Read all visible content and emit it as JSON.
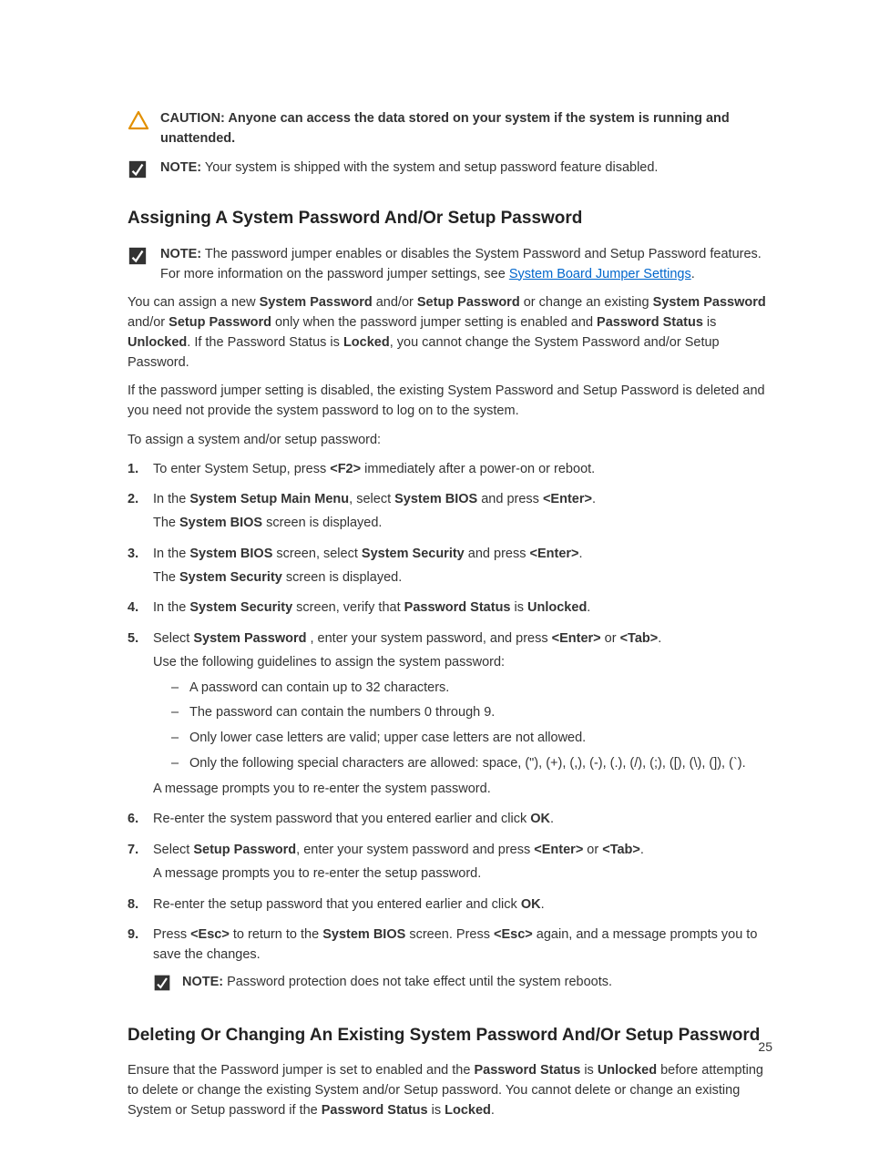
{
  "caution": {
    "label": "CAUTION:",
    "text": "Anyone can access the data stored on your system if the system is running and unattended."
  },
  "note1": {
    "label": "NOTE:",
    "text": "Your system is shipped with the system and setup password feature disabled."
  },
  "heading1": "Assigning A System Password And/Or Setup Password",
  "note2": {
    "label": "NOTE:",
    "pre": "The password jumper enables or disables the System Password and Setup Password features. For more information on the password jumper settings, see ",
    "link": "System Board Jumper Settings",
    "post": "."
  },
  "para1": {
    "p1": "You can assign a new ",
    "b1": "System Password",
    "p2": " and/or ",
    "b2": "Setup Password",
    "p3": " or change an existing ",
    "b3": "System Password",
    "p4": " and/or ",
    "b4": "Setup Password",
    "p5": " only when the password jumper setting is enabled and ",
    "b5": "Password Status",
    "p6": " is ",
    "b6": "Unlocked",
    "p7": ". If the Password Status is ",
    "b7": "Locked",
    "p8": ", you cannot change the System Password and/or Setup Password."
  },
  "para2": "If the password jumper setting is disabled, the existing System Password and Setup Password is deleted and you need not provide the system password to log on to the system.",
  "para3": "To assign a system and/or setup password:",
  "steps": [
    {
      "n": "1.",
      "lines": [
        {
          "segs": [
            {
              "t": "To enter System Setup, press "
            },
            {
              "t": "<F2>",
              "b": true
            },
            {
              "t": " immediately after a power-on or reboot."
            }
          ]
        }
      ]
    },
    {
      "n": "2.",
      "lines": [
        {
          "segs": [
            {
              "t": "In the "
            },
            {
              "t": "System Setup Main Menu",
              "b": true
            },
            {
              "t": ", select "
            },
            {
              "t": "System BIOS",
              "b": true
            },
            {
              "t": " and press "
            },
            {
              "t": "<Enter>",
              "b": true
            },
            {
              "t": "."
            }
          ]
        },
        {
          "segs": [
            {
              "t": "The "
            },
            {
              "t": "System BIOS",
              "b": true
            },
            {
              "t": " screen is displayed."
            }
          ]
        }
      ]
    },
    {
      "n": "3.",
      "lines": [
        {
          "segs": [
            {
              "t": "In the "
            },
            {
              "t": "System BIOS",
              "b": true
            },
            {
              "t": " screen, select "
            },
            {
              "t": "System Security",
              "b": true
            },
            {
              "t": " and press "
            },
            {
              "t": "<Enter>",
              "b": true
            },
            {
              "t": "."
            }
          ]
        },
        {
          "segs": [
            {
              "t": "The "
            },
            {
              "t": "System Security",
              "b": true
            },
            {
              "t": " screen is displayed."
            }
          ]
        }
      ]
    },
    {
      "n": "4.",
      "lines": [
        {
          "segs": [
            {
              "t": "In the "
            },
            {
              "t": "System Security",
              "b": true
            },
            {
              "t": " screen, verify that "
            },
            {
              "t": "Password Status",
              "b": true
            },
            {
              "t": " is "
            },
            {
              "t": "Unlocked",
              "b": true
            },
            {
              "t": "."
            }
          ]
        }
      ]
    },
    {
      "n": "5.",
      "lines": [
        {
          "segs": [
            {
              "t": "Select "
            },
            {
              "t": "System Password",
              "b": true
            },
            {
              "t": " , enter your system password, and press "
            },
            {
              "t": "<Enter>",
              "b": true
            },
            {
              "t": " or "
            },
            {
              "t": "<Tab>",
              "b": true
            },
            {
              "t": "."
            }
          ]
        },
        {
          "segs": [
            {
              "t": "Use the following guidelines to assign the system password:"
            }
          ]
        }
      ],
      "bullets": [
        "A password can contain up to 32 characters.",
        "The password can contain the numbers 0 through 9.",
        "Only lower case letters are valid; upper case letters are not allowed.",
        "Only the following special characters are allowed: space, (\"), (+), (,), (-), (.), (/), (;), ([), (\\), (]), (`)."
      ],
      "after": [
        {
          "segs": [
            {
              "t": "A message prompts you to re-enter the system password."
            }
          ]
        }
      ]
    },
    {
      "n": "6.",
      "lines": [
        {
          "segs": [
            {
              "t": "Re-enter the system password that you entered earlier and click "
            },
            {
              "t": "OK",
              "b": true
            },
            {
              "t": "."
            }
          ]
        }
      ]
    },
    {
      "n": "7.",
      "lines": [
        {
          "segs": [
            {
              "t": "Select "
            },
            {
              "t": "Setup Password",
              "b": true
            },
            {
              "t": ", enter your system password and press "
            },
            {
              "t": "<Enter>",
              "b": true
            },
            {
              "t": " or "
            },
            {
              "t": "<Tab>",
              "b": true
            },
            {
              "t": "."
            }
          ]
        },
        {
          "segs": [
            {
              "t": "A message prompts you to re-enter the setup password."
            }
          ]
        }
      ]
    },
    {
      "n": "8.",
      "lines": [
        {
          "segs": [
            {
              "t": "Re-enter the setup password that you entered earlier and click "
            },
            {
              "t": "OK",
              "b": true
            },
            {
              "t": "."
            }
          ]
        }
      ]
    },
    {
      "n": "9.",
      "lines": [
        {
          "segs": [
            {
              "t": "Press "
            },
            {
              "t": "<Esc>",
              "b": true
            },
            {
              "t": " to return to the "
            },
            {
              "t": "System BIOS",
              "b": true
            },
            {
              "t": " screen. Press "
            },
            {
              "t": "<Esc>",
              "b": true
            },
            {
              "t": " again, and a message prompts you to save the changes."
            }
          ]
        }
      ],
      "note": {
        "label": "NOTE:",
        "text": "Password protection does not take effect until the system reboots."
      }
    }
  ],
  "heading2": "Deleting Or Changing An Existing System Password And/Or Setup Password",
  "para4": {
    "p1": "Ensure that the Password jumper is set to enabled and the ",
    "b1": "Password Status",
    "p2": " is ",
    "b2": "Unlocked",
    "p3": " before attempting to delete or change the existing System and/or Setup password. You cannot delete or change an existing System or Setup password if the ",
    "b3": "Password Status",
    "p4": " is ",
    "b4": "Locked",
    "p5": "."
  },
  "pageNumber": "25"
}
